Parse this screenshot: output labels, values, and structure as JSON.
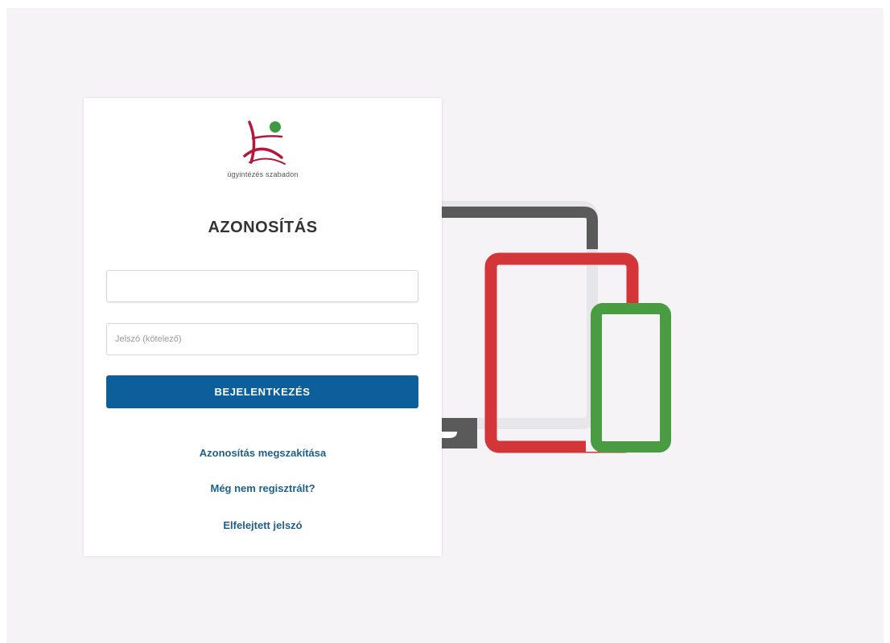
{
  "brand": {
    "tagline": "ügyintézés szabadon",
    "logo_colors": {
      "red": "#b5173a",
      "green": "#3c9a3f"
    }
  },
  "login": {
    "title": "AZONOSÍTÁS",
    "username_value": "",
    "username_placeholder": "",
    "password_placeholder": "Jelszó (kötelező)",
    "submit_label": "BEJELENTKEZÉS"
  },
  "links": {
    "cancel": "Azonosítás megszakítása",
    "register": "Még nem regisztrált?",
    "forgot_password": "Elfelejtett jelszó"
  },
  "colors": {
    "primary_button": "#0c5f9a",
    "link": "#1f5f8c",
    "laptop": "#5a5a5a",
    "tablet": "#d43539",
    "phone": "#4a9c43",
    "background": "#f5f3f6"
  }
}
